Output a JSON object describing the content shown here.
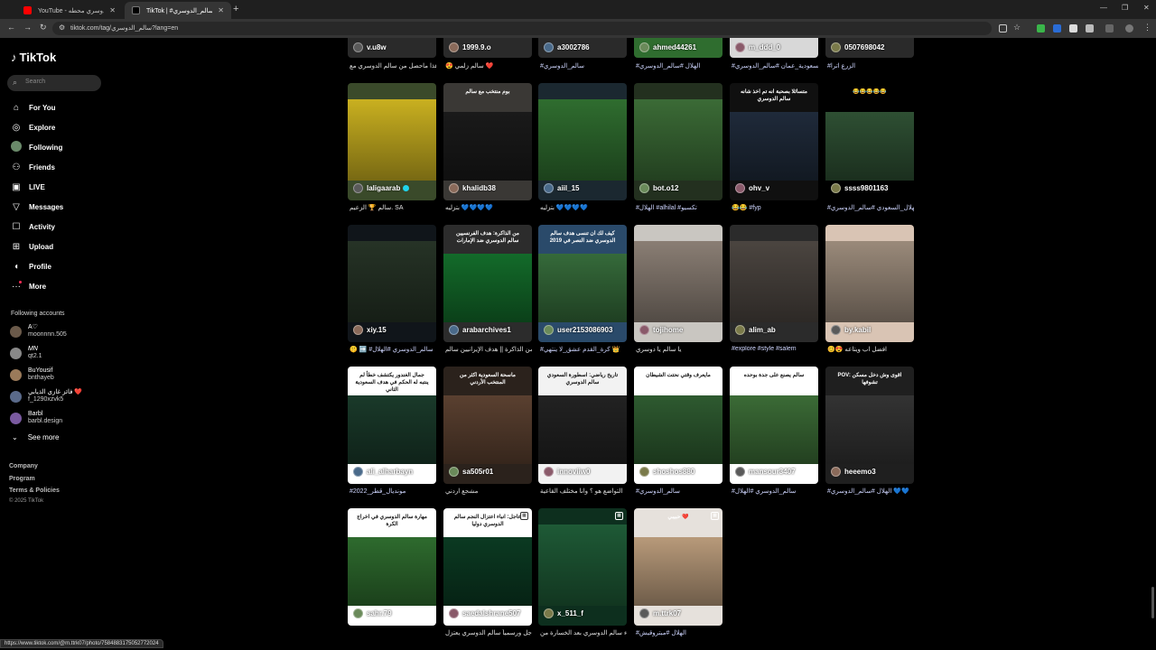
{
  "browser": {
    "tabs": [
      {
        "title": "YouTube - سالم الدوسري محطه",
        "favicon_color": "#ff0000",
        "active": false
      },
      {
        "title": "TikTok | #سالم_الدوسري",
        "favicon_color": "#000000",
        "active": true
      }
    ],
    "url": "tiktok.com/tag/سالم_الدوسري?lang=en",
    "status_url": "https://www.tiktok.com/@m.ttrk07/photo/7584883175052772024"
  },
  "sidebar": {
    "logo": "TikTok",
    "search_placeholder": "Search",
    "nav": [
      {
        "label": "For You",
        "icon": "home-icon"
      },
      {
        "label": "Explore",
        "icon": "compass-icon"
      },
      {
        "label": "Following",
        "icon": "following-avatar-icon"
      },
      {
        "label": "Friends",
        "icon": "friends-icon"
      },
      {
        "label": "LIVE",
        "icon": "live-icon"
      },
      {
        "label": "Messages",
        "icon": "send-icon"
      },
      {
        "label": "Activity",
        "icon": "activity-icon"
      },
      {
        "label": "Upload",
        "icon": "upload-icon"
      },
      {
        "label": "Profile",
        "icon": "profile-icon"
      },
      {
        "label": "More",
        "icon": "more-icon"
      }
    ],
    "following_title": "Following accounts",
    "accounts": [
      {
        "name": "A♡",
        "handle": "moonnnn.505",
        "avatar_color": "#6b5a4a"
      },
      {
        "name": "𝑀𝑁",
        "handle": "qt2.1",
        "avatar_color": "#888888"
      },
      {
        "name": "BuYousif",
        "handle": "bnthayeb",
        "avatar_color": "#9a7a5a"
      },
      {
        "name": "فائز غازي الذيابي ❤️",
        "handle": "f_1290xzvk5",
        "avatar_color": "#5a6a8a"
      },
      {
        "name": "Barbl",
        "handle": "barbl.design",
        "avatar_color": "#7a5aa0"
      }
    ],
    "see_more": "See more",
    "footer": [
      "Company",
      "Program",
      "Terms & Policies"
    ],
    "copyright": "© 2025 TikTok"
  },
  "grid": {
    "top_row": [
      {
        "user": "v.u8w",
        "caption": "هذا ماحصل من سالم الدوسري مع"
      },
      {
        "user": "1999.9.o",
        "caption": "😍 سالم زلمي ❤️"
      },
      {
        "user": "a3002786",
        "caption": "#سالم_الدوسري"
      },
      {
        "user": "ahmed44261",
        "caption": "#الهلال #سالم_الدوسري"
      },
      {
        "user": "m_ddd_0",
        "caption": "#السعودية_عمان #سالم_الدوسري"
      },
      {
        "user": "0507698042",
        "caption": "#الزرع اترا"
      }
    ],
    "rows": [
      [
        {
          "user": "laligaarab",
          "verified": true,
          "caption": "سالم 🏆 الزعيم. SA",
          "bg": "#3a4a2a",
          "art": "#c9b020"
        },
        {
          "user": "khalidb38",
          "caption": "بتزليه 💙💙💙💙",
          "bg": "#3a3835",
          "art": "#1a1a1a",
          "overlay": "بوم منتخب مع سالم"
        },
        {
          "user": "aiil_15",
          "caption": "بتزليه 💙💙💙💙",
          "bg": "#1b2830",
          "art": "#2f6d2f"
        },
        {
          "user": "bot.o12",
          "caption": "#الهلال #alhilal #تكسيو",
          "bg": "#23301f",
          "art": "#3b6b36"
        },
        {
          "user": "ohv_v",
          "caption": "😂😂 #fyp",
          "bg": "#101010",
          "art": "#1f2a3a",
          "overlay": "متسائلا بصحبة انه تم اخذ شانه سالم الدوسري"
        },
        {
          "user": "ssss9801163",
          "caption": "#الهلال_السعودي #سالم_الدوسري",
          "bg": "#000000",
          "art": "#2e4f33",
          "overlay": "😂😂😂😂😂"
        }
      ],
      [
        {
          "user": "xiy.15",
          "caption": "🤫 ➡️ #سالم_الدوسري #الهلال",
          "bg": "#10151a",
          "art": "#263326"
        },
        {
          "user": "arabarchives1",
          "caption": "من الذاكرة || هدف الإيرانيين سالم",
          "bg": "#2c2c2c",
          "art": "#136b2a",
          "overlay": "من الذاكرة: هدف الفرنسيين سالم الدوسري ضد الإمارات"
        },
        {
          "user": "user2153086903",
          "caption": "#كرة_القدم عشق_لا ينتهي 👑",
          "bg": "#2a4a6a",
          "art": "#356a3a",
          "overlay": "كيف لك ان تنسى هدف سالم الدوسري ضد النصر في 2019"
        },
        {
          "user": "tojihome",
          "caption": "يا سالم يا دوسري",
          "bg": "#c9c6c1",
          "art": "#8a7e74"
        },
        {
          "user": "alim_ab",
          "caption": "#explore #style #salem",
          "bg": "#2b2b2b",
          "art": "#4b4540"
        },
        {
          "user": "by.kabil",
          "caption": "😊😍 افضل اب ويتاعه",
          "bg": "#d9c4b4",
          "art": "#9a8a7a"
        }
      ],
      [
        {
          "user": "ali_alharbayn",
          "caption": "#2022_مونديال_قطر",
          "bg": "#ffffff",
          "art": "#1a3a2a",
          "overlay": "جمال الغندور يكتشف خطأ لم ينتبه له الحكم في هدف السعودية الثاني"
        },
        {
          "user": "sa505r01",
          "caption": "مشجع اردني",
          "bg": "#2b221c",
          "art": "#5a4030",
          "overlay": "ماسحة السعودية اكثر من المنتخب الأردني"
        },
        {
          "user": "innoviiw0",
          "caption": "التواضع هو ؟ وانا مختلف القاعية",
          "bg": "#f2f2f2",
          "art": "#222222",
          "overlay": "تاريخ رياضي: اسطورة السعودي سالم الدوسري"
        },
        {
          "user": "shoshos880",
          "caption": "#سالم_الدوسري",
          "bg": "#ffffff",
          "art": "#2e5a30",
          "overlay": "مايعرف وقتي نحتت الشيطان"
        },
        {
          "user": "mansour3407",
          "caption": "#سالم_الدوسري #الهلال",
          "bg": "#ffffff",
          "art": "#3b6b36",
          "overlay": "سالم يصنع على جدة بوحده"
        },
        {
          "user": "heeemo3",
          "caption": "#الهلال #سالم_الدوسري 💙💙",
          "bg": "#1f1f1f",
          "art": "#333333",
          "overlay": "POV: اقوى وش دخل مسكن تشوفها"
        }
      ],
      [
        {
          "user": "sahr.79",
          "caption": "",
          "bg": "#ffffff",
          "art": "#2e6b2e",
          "overlay": "مهارة سالم الدوسري في اخراج الكرة"
        },
        {
          "user": "saedalshrane507",
          "caption": "عاجل ورسمياً سالم الدوسري يعتزل",
          "bg": "#ffffff",
          "art": "#0b3a22",
          "overlay": "عاجل: انباء اعتزال النجم سالم الدوسري دوليا",
          "pic": true
        },
        {
          "user": "x_511_f",
          "caption": "بكاء سالم الدوسري بعد الخسارة من",
          "bg": "#0d2f1e",
          "art": "#1e5a36",
          "pic": true
        },
        {
          "user": "m.ttrk07",
          "caption": "#الهلال #مبتروقيش",
          "bg": "#e6e1dc",
          "art": "#b89a7a",
          "overlay": "حبيبي ❤️",
          "pic": true
        }
      ]
    ]
  }
}
